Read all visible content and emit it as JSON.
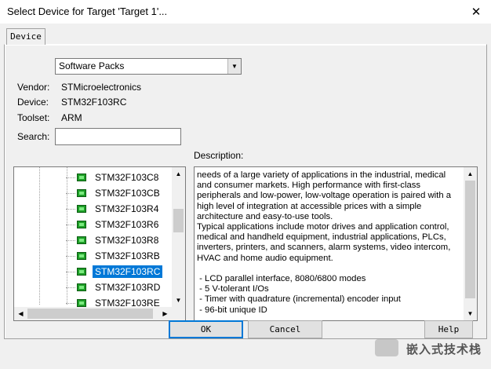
{
  "window": {
    "title": "Select Device for Target 'Target 1'...",
    "close_glyph": "✕"
  },
  "tabs": [
    {
      "label": "Device"
    }
  ],
  "device_source": {
    "selected": "Software Packs"
  },
  "info": {
    "vendor_label": "Vendor:",
    "vendor_value": "STMicroelectronics",
    "device_label": "Device:",
    "device_value": "STM32F103RC",
    "toolset_label": "Toolset:",
    "toolset_value": "ARM",
    "search_label": "Search:",
    "search_value": ""
  },
  "description_label": "Description:",
  "device_list": [
    {
      "name": "STM32F103C8",
      "selected": false
    },
    {
      "name": "STM32F103CB",
      "selected": false
    },
    {
      "name": "STM32F103R4",
      "selected": false
    },
    {
      "name": "STM32F103R6",
      "selected": false
    },
    {
      "name": "STM32F103R8",
      "selected": false
    },
    {
      "name": "STM32F103RB",
      "selected": false
    },
    {
      "name": "STM32F103RC",
      "selected": true
    },
    {
      "name": "STM32F103RD",
      "selected": false
    },
    {
      "name": "STM32F103RE",
      "selected": false
    }
  ],
  "description_text": "needs of a large variety of applications in the industrial, medical and consumer markets. High performance with first-class peripherals and low-power, low-voltage operation is paired with a high level of integration at accessible prices with a simple architecture and easy-to-use tools.\nTypical applications include motor drives and application control, medical and handheld equipment, industrial applications, PLCs, inverters, printers, and scanners, alarm systems, video intercom, HVAC and home audio equipment.\n\n - LCD parallel interface, 8080/6800 modes\n - 5 V-tolerant I/Os\n - Timer with quadrature (incremental) encoder input\n - 96-bit unique ID",
  "buttons": {
    "ok": "OK",
    "cancel": "Cancel",
    "help": "Help"
  },
  "watermark": {
    "text": "嵌入式技术栈"
  }
}
